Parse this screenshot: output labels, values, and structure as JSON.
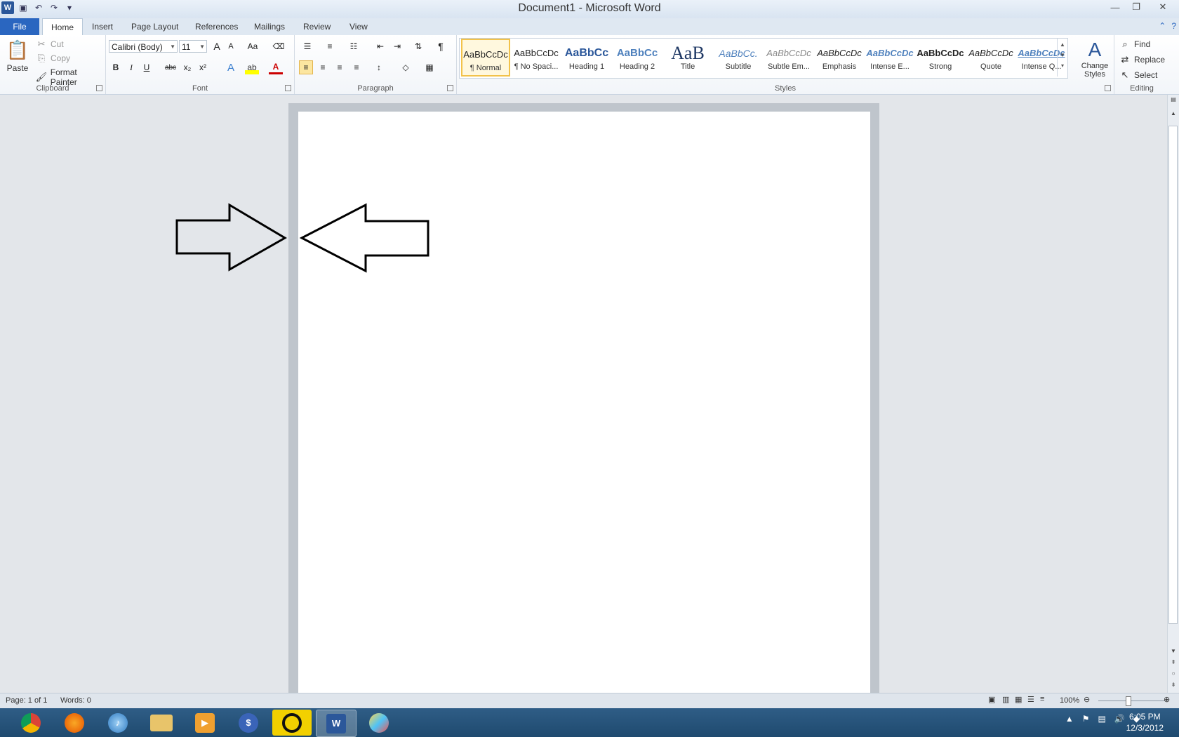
{
  "window": {
    "title": "Document1 - Microsoft Word"
  },
  "qat": {
    "save": "save-icon",
    "undo": "undo-icon",
    "redo": "redo-icon",
    "customize": "▾"
  },
  "tabs": [
    {
      "label": "File"
    },
    {
      "label": "Home"
    },
    {
      "label": "Insert"
    },
    {
      "label": "Page Layout"
    },
    {
      "label": "References"
    },
    {
      "label": "Mailings"
    },
    {
      "label": "Review"
    },
    {
      "label": "View"
    }
  ],
  "clipboard": {
    "paste": "Paste",
    "cut": "Cut",
    "copy": "Copy",
    "format_painter": "Format Painter",
    "group": "Clipboard"
  },
  "font": {
    "name": "Calibri (Body)",
    "size": "11",
    "group": "Font",
    "bold": "B",
    "italic": "I",
    "underline": "U",
    "strike": "abc",
    "sub": "x₂",
    "sup": "x²",
    "grow": "A",
    "shrink": "A",
    "case": "Aa"
  },
  "paragraph": {
    "group": "Paragraph",
    "pilcrow": "¶"
  },
  "styles": {
    "group": "Styles",
    "items": [
      {
        "preview": "AaBbCcDc",
        "name": "¶ Normal"
      },
      {
        "preview": "AaBbCcDc",
        "name": "¶ No Spaci..."
      },
      {
        "preview": "AaBbCc",
        "name": "Heading 1"
      },
      {
        "preview": "AaBbCc",
        "name": "Heading 2"
      },
      {
        "preview": "AaB",
        "name": "Title"
      },
      {
        "preview": "AaBbCc.",
        "name": "Subtitle"
      },
      {
        "preview": "AaBbCcDc",
        "name": "Subtle Em..."
      },
      {
        "preview": "AaBbCcDc",
        "name": "Emphasis"
      },
      {
        "preview": "AaBbCcDc",
        "name": "Intense E..."
      },
      {
        "preview": "AaBbCcDc",
        "name": "Strong"
      },
      {
        "preview": "AaBbCcDc",
        "name": "Quote"
      },
      {
        "preview": "AaBbCcDc",
        "name": "Intense Q..."
      }
    ],
    "change_styles": "Change Styles"
  },
  "editing": {
    "group": "Editing",
    "find": "Find",
    "replace": "Replace",
    "select": "Select"
  },
  "status": {
    "page": "Page: 1 of 1",
    "words": "Words: 0",
    "zoom": "100%"
  },
  "taskbar": {
    "time": "6:05 PM",
    "date": "12/3/2012"
  },
  "colors": {
    "file_tab": "#2a66c0",
    "accent_blue": "#2b579a",
    "taskbar": "#2a557c"
  }
}
